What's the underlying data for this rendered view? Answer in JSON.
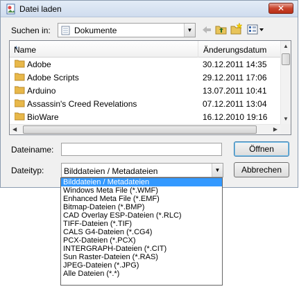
{
  "window": {
    "title": "Datei laden"
  },
  "location": {
    "label": "Suchen in:",
    "value": "Dokumente"
  },
  "file_list": {
    "columns": {
      "name": "Name",
      "modified": "Änderungsdatum"
    },
    "rows": [
      {
        "name": "Adobe",
        "modified": "30.12.2011 14:35"
      },
      {
        "name": "Adobe Scripts",
        "modified": "29.12.2011 17:06"
      },
      {
        "name": "Arduino",
        "modified": "13.07.2011 10:41"
      },
      {
        "name": "Assassin's Creed Revelations",
        "modified": "07.12.2011 13:04"
      },
      {
        "name": "BioWare",
        "modified": "16.12.2010 19:16"
      }
    ]
  },
  "filename": {
    "label": "Dateiname:",
    "value": ""
  },
  "filetype": {
    "label": "Dateityp:",
    "value": "Bilddateien / Metadateien",
    "options": [
      "Bilddateien / Metadateien",
      "Windows Meta File (*.WMF)",
      "Enhanced Meta File (*.EMF)",
      "Bitmap-Dateien (*.BMP)",
      "CAD Overlay ESP-Dateien (*.RLC)",
      "TIFF-Dateien (*.TIF)",
      "CALS G4-Dateien (*.CG4)",
      "PCX-Dateien (*.PCX)",
      "INTERGRAPH-Dateien (*.CIT)",
      "Sun Raster-Dateien (*.RAS)",
      "JPEG-Dateien (*.JPG)",
      "Alle Dateien (*.*)"
    ],
    "selected_index": 0
  },
  "buttons": {
    "open": "Öffnen",
    "cancel": "Abbrechen",
    "close": "✕"
  },
  "colors": {
    "selection": "#3399ff",
    "folder": "#e8b84a",
    "close": "#c8442c"
  },
  "icons": [
    "app-icon",
    "folder-icon",
    "back-arrow-icon",
    "up-folder-icon",
    "new-folder-icon",
    "view-menu-icon"
  ]
}
